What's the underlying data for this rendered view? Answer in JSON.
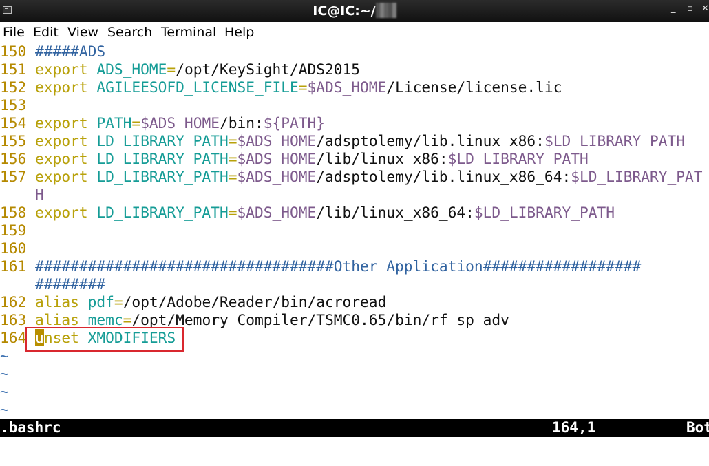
{
  "window": {
    "title": "IC@IC:~/",
    "minimize_glyph": "_",
    "maximize_glyph": "▫",
    "close_glyph": "✕"
  },
  "menu": [
    "File",
    "Edit",
    "View",
    "Search",
    "Terminal",
    "Help"
  ],
  "editor": {
    "rows": [
      {
        "n": "150",
        "segs": [
          {
            "t": "#####ADS",
            "c": "cmt"
          }
        ]
      },
      {
        "n": "151",
        "segs": [
          {
            "t": "export",
            "c": "kw"
          },
          {
            "t": " ",
            "c": "path"
          },
          {
            "t": "ADS_HOME",
            "c": "var"
          },
          {
            "t": "=",
            "c": "op"
          },
          {
            "t": "/opt/KeySight/ADS2015",
            "c": "path"
          }
        ]
      },
      {
        "n": "152",
        "segs": [
          {
            "t": "export",
            "c": "kw"
          },
          {
            "t": " ",
            "c": "path"
          },
          {
            "t": "AGILEESOFD_LICENSE_FILE",
            "c": "var"
          },
          {
            "t": "=",
            "c": "op"
          },
          {
            "t": "$ADS_HOME",
            "c": "dollar"
          },
          {
            "t": "/License/license.lic",
            "c": "path"
          }
        ]
      },
      {
        "n": "153",
        "segs": []
      },
      {
        "n": "154",
        "segs": [
          {
            "t": "export",
            "c": "kw"
          },
          {
            "t": " ",
            "c": "path"
          },
          {
            "t": "PATH",
            "c": "var"
          },
          {
            "t": "=",
            "c": "op"
          },
          {
            "t": "$ADS_HOME",
            "c": "dollar"
          },
          {
            "t": "/bin:",
            "c": "path"
          },
          {
            "t": "${PATH}",
            "c": "dollar"
          }
        ]
      },
      {
        "n": "155",
        "segs": [
          {
            "t": "export",
            "c": "kw"
          },
          {
            "t": " ",
            "c": "path"
          },
          {
            "t": "LD_LIBRARY_PATH",
            "c": "var"
          },
          {
            "t": "=",
            "c": "op"
          },
          {
            "t": "$ADS_HOME",
            "c": "dollar"
          },
          {
            "t": "/adsptolemy/lib.linux_x86:",
            "c": "path"
          },
          {
            "t": "$LD_LIBRARY_PATH",
            "c": "dollar"
          }
        ]
      },
      {
        "n": "156",
        "segs": [
          {
            "t": "export",
            "c": "kw"
          },
          {
            "t": " ",
            "c": "path"
          },
          {
            "t": "LD_LIBRARY_PATH",
            "c": "var"
          },
          {
            "t": "=",
            "c": "op"
          },
          {
            "t": "$ADS_HOME",
            "c": "dollar"
          },
          {
            "t": "/lib/linux_x86:",
            "c": "path"
          },
          {
            "t": "$LD_LIBRARY_PATH",
            "c": "dollar"
          }
        ]
      },
      {
        "n": "157",
        "segs": [
          {
            "t": "export",
            "c": "kw"
          },
          {
            "t": " ",
            "c": "path"
          },
          {
            "t": "LD_LIBRARY_PATH",
            "c": "var"
          },
          {
            "t": "=",
            "c": "op"
          },
          {
            "t": "$ADS_HOME",
            "c": "dollar"
          },
          {
            "t": "/adsptolemy/lib.linux_x86_64:",
            "c": "path"
          },
          {
            "t": "$LD_LIBRARY_PAT",
            "c": "dollar"
          }
        ]
      },
      {
        "n": "",
        "segs": [
          {
            "t": "H",
            "c": "dollar"
          }
        ]
      },
      {
        "n": "158",
        "segs": [
          {
            "t": "export",
            "c": "kw"
          },
          {
            "t": " ",
            "c": "path"
          },
          {
            "t": "LD_LIBRARY_PATH",
            "c": "var"
          },
          {
            "t": "=",
            "c": "op"
          },
          {
            "t": "$ADS_HOME",
            "c": "dollar"
          },
          {
            "t": "/lib/linux_x86_64:",
            "c": "path"
          },
          {
            "t": "$LD_LIBRARY_PATH",
            "c": "dollar"
          }
        ]
      },
      {
        "n": "159",
        "segs": []
      },
      {
        "n": "160",
        "segs": []
      },
      {
        "n": "161",
        "segs": [
          {
            "t": "##################################Other Application##################",
            "c": "cmt"
          }
        ]
      },
      {
        "n": "",
        "segs": [
          {
            "t": "########",
            "c": "cmt"
          }
        ]
      },
      {
        "n": "162",
        "segs": [
          {
            "t": "alias",
            "c": "kw"
          },
          {
            "t": " ",
            "c": "path"
          },
          {
            "t": "pdf",
            "c": "var"
          },
          {
            "t": "=",
            "c": "op"
          },
          {
            "t": "/opt/Adobe/Reader/bin/acroread",
            "c": "path"
          }
        ]
      },
      {
        "n": "163",
        "segs": [
          {
            "t": "alias",
            "c": "kw"
          },
          {
            "t": " ",
            "c": "path"
          },
          {
            "t": "memc",
            "c": "var"
          },
          {
            "t": "=",
            "c": "op"
          },
          {
            "t": "/opt/Memory_Compiler/TSMC0.65/bin/rf_sp_adv",
            "c": "path"
          }
        ]
      },
      {
        "n": "164",
        "segs": [
          {
            "t": "u",
            "c": "cursor"
          },
          {
            "t": "nset",
            "c": "kw"
          },
          {
            "t": " ",
            "c": "path"
          },
          {
            "t": "XMODIFIERS",
            "c": "var"
          }
        ]
      },
      {
        "n": "~",
        "segs": []
      },
      {
        "n": "~",
        "segs": []
      },
      {
        "n": "~",
        "segs": []
      },
      {
        "n": "~",
        "segs": []
      }
    ]
  },
  "status": {
    "filename": ".bashrc",
    "position": "164,1",
    "scroll": "Bot"
  },
  "colors": {
    "keyword": "#b8a10a",
    "variable": "#159c96",
    "dollar": "#7d5a8c",
    "comment": "#3163a0",
    "line_number": "#b58900",
    "cursor": "#b88f00",
    "highlight_box": "#d9282f"
  }
}
